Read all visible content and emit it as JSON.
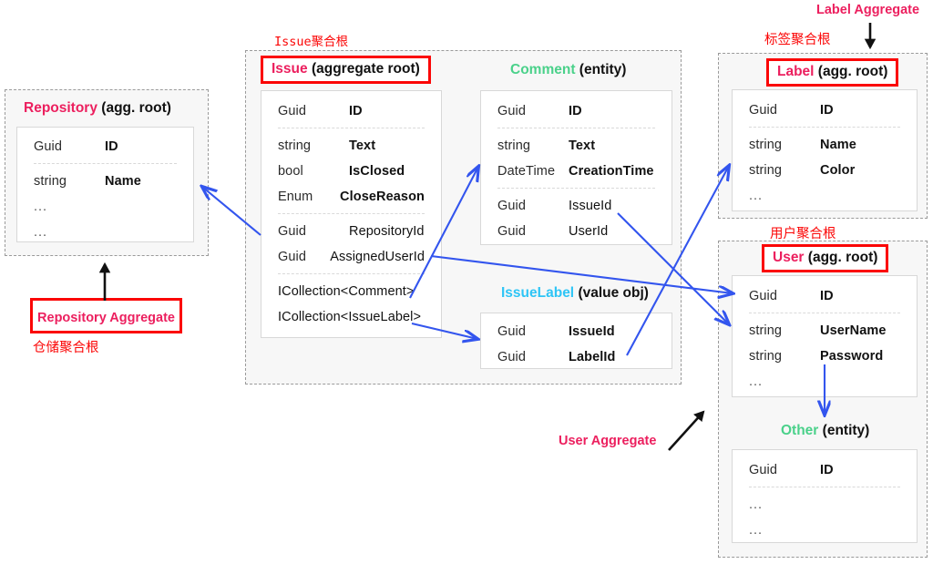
{
  "colors": {
    "aggregate_root_name": "#ec1f5e",
    "entity_name": "#4ad18a",
    "value_object_name": "#2ec5f6",
    "red_border": "#fb0606",
    "arrow_blue": "#3355ee",
    "arrow_black": "#111111",
    "container_bg": "#f7f7f7"
  },
  "annotations": {
    "repository_aggregate": "Repository Aggregate",
    "repository_aggregate_cn": "仓储聚合根",
    "issue_aggregate_cn": "Issue聚合根",
    "label_aggregate": "Label Aggregate",
    "label_aggregate_cn": "标签聚合根",
    "user_aggregate": "User Aggregate",
    "user_aggregate_cn": "用户聚合根"
  },
  "boxes": {
    "repository": {
      "name": "Repository",
      "kind": "(agg. root)",
      "fields": [
        {
          "type": "Guid",
          "name": "ID",
          "bold": true
        },
        {
          "separator": true
        },
        {
          "type": "string",
          "name": "Name",
          "bold": true
        },
        {
          "type": "...",
          "name": "",
          "dots": true
        },
        {
          "type": "...",
          "name": "",
          "dots": true
        }
      ]
    },
    "issue": {
      "name": "Issue",
      "kind": "(aggregate root)",
      "fields": [
        {
          "type": "Guid",
          "name": "ID",
          "bold": true
        },
        {
          "separator": true
        },
        {
          "type": "string",
          "name": "Text",
          "bold": true
        },
        {
          "type": "bool",
          "name": "IsClosed",
          "bold": true
        },
        {
          "type": "Enum",
          "name": "CloseReason",
          "bold": true
        },
        {
          "separator": true
        },
        {
          "type": "Guid",
          "name": "RepositoryId",
          "bold": false
        },
        {
          "type": "Guid",
          "name": "AssignedUserId",
          "bold": false
        },
        {
          "separator": true
        },
        {
          "type": "ICollection<Comment>",
          "name": "",
          "wide": true
        },
        {
          "type": "ICollection<IssueLabel>",
          "name": "",
          "wide": true
        }
      ]
    },
    "comment": {
      "name": "Comment",
      "kind": "(entity)",
      "fields": [
        {
          "type": "Guid",
          "name": "ID",
          "bold": true
        },
        {
          "separator": true
        },
        {
          "type": "string",
          "name": "Text",
          "bold": true
        },
        {
          "type": "DateTime",
          "name": "CreationTime",
          "bold": true
        },
        {
          "separator": true
        },
        {
          "type": "Guid",
          "name": "IssueId",
          "bold": false
        },
        {
          "type": "Guid",
          "name": "UserId",
          "bold": false
        }
      ]
    },
    "issuelabel": {
      "name": "IssueLabel",
      "kind": "(value obj)",
      "fields": [
        {
          "type": "Guid",
          "name": "IssueId",
          "bold": true
        },
        {
          "type": "Guid",
          "name": "LabelId",
          "bold": true
        }
      ]
    },
    "label": {
      "name": "Label",
      "kind": "(agg. root)",
      "fields": [
        {
          "type": "Guid",
          "name": "ID",
          "bold": true
        },
        {
          "separator": true
        },
        {
          "type": "string",
          "name": "Name",
          "bold": true
        },
        {
          "type": "string",
          "name": "Color",
          "bold": true
        },
        {
          "type": "...",
          "name": "",
          "dots": true
        }
      ]
    },
    "user": {
      "name": "User",
      "kind": "(agg. root)",
      "fields": [
        {
          "type": "Guid",
          "name": "ID",
          "bold": true
        },
        {
          "separator": true
        },
        {
          "type": "string",
          "name": "UserName",
          "bold": true
        },
        {
          "type": "string",
          "name": "Password",
          "bold": true
        },
        {
          "type": "...",
          "name": "",
          "dots": true
        }
      ]
    },
    "other": {
      "name": "Other",
      "kind": "(entity)",
      "fields": [
        {
          "type": "Guid",
          "name": "ID",
          "bold": true
        },
        {
          "separator": true
        },
        {
          "type": "...",
          "name": "",
          "dots": true
        },
        {
          "type": "...",
          "name": "",
          "dots": true
        }
      ]
    }
  },
  "relations": [
    {
      "from": "Issue.RepositoryId",
      "to": "Repository"
    },
    {
      "from": "Issue.ICollection<Comment>",
      "to": "Comment"
    },
    {
      "from": "Issue.ICollection<IssueLabel>",
      "to": "IssueLabel"
    },
    {
      "from": "Issue.AssignedUserId",
      "to": "User"
    },
    {
      "from": "Comment.IssueId",
      "to": "User"
    },
    {
      "from": "IssueLabel.LabelId",
      "to": "Label"
    },
    {
      "from": "User",
      "to": "Other"
    }
  ]
}
